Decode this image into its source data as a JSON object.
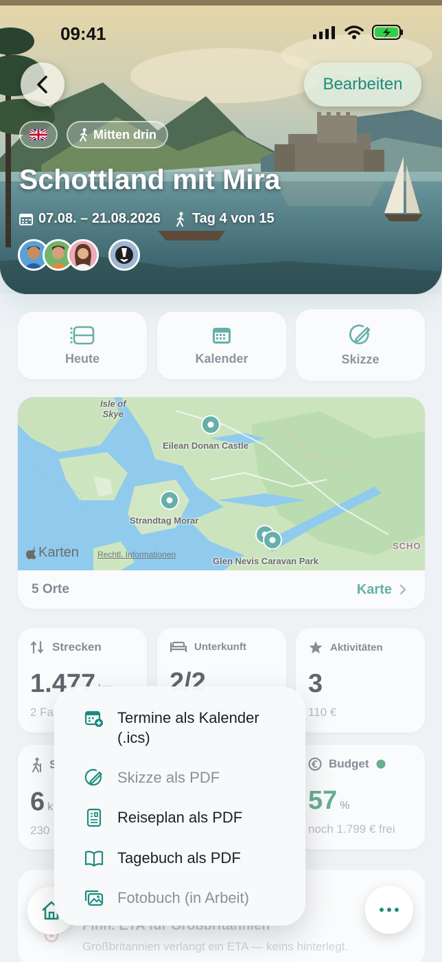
{
  "status": {
    "time": "09:41"
  },
  "header": {
    "edit_label": "Bearbeiten",
    "status_chip": "Mitten drin",
    "title": "Schottland mit Mira",
    "dates": "07.08. – 21.08.2026",
    "day": "Tag 4 von 15"
  },
  "quick_actions": [
    {
      "label": "Heute",
      "icon": "list-icon"
    },
    {
      "label": "Kalender",
      "icon": "calendar-icon"
    },
    {
      "label": "Skizze",
      "icon": "sketch-icon"
    }
  ],
  "map": {
    "labels": {
      "isle": "Isle of\nSkye",
      "eilean": "Eilean Donan Castle",
      "morar": "Strandtag Morar",
      "glen": "Glen Nevis Caravan Park",
      "scho": "SCHO",
      "brand": "Karten",
      "legal": "Rechtl. Informationen"
    },
    "count": "5 Orte",
    "link": "Karte"
  },
  "stats": {
    "strecken": {
      "label": "Strecken",
      "value": "1.477",
      "unit": "km",
      "sub": "2 Fa"
    },
    "unterkunft": {
      "label": "Unterkunft",
      "value": "2/2"
    },
    "aktivitaeten": {
      "label": "Aktivitäten",
      "value": "3",
      "sub": "110 €"
    },
    "wandern": {
      "label": "S",
      "value": "6",
      "unit": "k",
      "sub": "230"
    },
    "budget": {
      "label": "Budget",
      "value": "57",
      "unit": "%",
      "sub": "noch 1.799 € frei"
    }
  },
  "note": {
    "title": "Fihn. ETA für Großbritannien",
    "subtitle": "Großbritannien verlangt ein ETA — keins hinterlegt."
  },
  "menu": {
    "items": [
      {
        "label": "Termine als Kalender (.ics)",
        "icon": "calendar-add-icon",
        "enabled": true
      },
      {
        "label": "Skizze als PDF",
        "icon": "sketch-icon",
        "enabled": false
      },
      {
        "label": "Reiseplan als PDF",
        "icon": "document-icon",
        "enabled": true
      },
      {
        "label": "Tagebuch als PDF",
        "icon": "book-icon",
        "enabled": true
      },
      {
        "label": "Fotobuch (in Arbeit)",
        "icon": "photos-icon",
        "enabled": false
      }
    ]
  },
  "colors": {
    "accent": "#1d8c7e",
    "budget_ok": "#1e8a5a"
  }
}
